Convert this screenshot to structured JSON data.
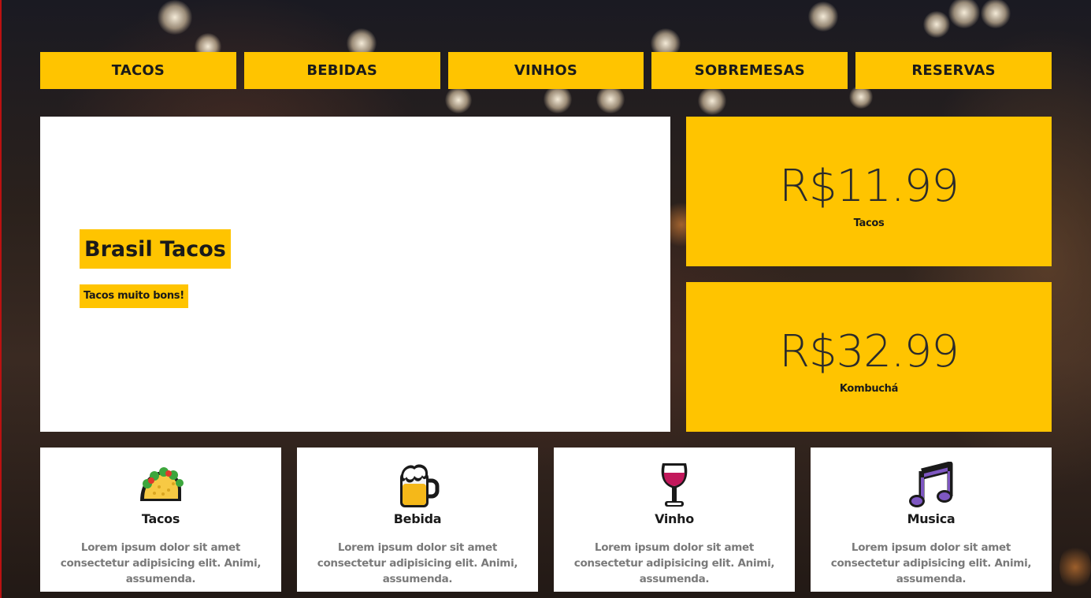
{
  "nav": {
    "items": [
      {
        "label": "TACOS"
      },
      {
        "label": "BEBIDAS"
      },
      {
        "label": "VINHOS"
      },
      {
        "label": "SOBREMESAS"
      },
      {
        "label": "RESERVAS"
      }
    ]
  },
  "hero": {
    "title": "Brasil Tacos",
    "subtitle": "Tacos muito bons!"
  },
  "prices": [
    {
      "value": "R$11.99",
      "label": "Tacos"
    },
    {
      "value": "R$32.99",
      "label": "Kombuchá"
    }
  ],
  "cards": [
    {
      "icon": "taco-icon",
      "title": "Tacos",
      "text": "Lorem ipsum dolor sit amet consectetur adipisicing elit. Animi, assumenda."
    },
    {
      "icon": "beer-mug-icon",
      "title": "Bebida",
      "text": "Lorem ipsum dolor sit amet consectetur adipisicing elit. Animi, assumenda."
    },
    {
      "icon": "wine-glass-icon",
      "title": "Vinho",
      "text": "Lorem ipsum dolor sit amet consectetur adipisicing elit. Animi, assumenda."
    },
    {
      "icon": "music-notes-icon",
      "title": "Musica",
      "text": "Lorem ipsum dolor sit amet consectetur adipisicing elit. Animi, assumenda."
    }
  ],
  "colors": {
    "accent": "#ffc400",
    "card": "#ffffff",
    "text": "#1a1a1a",
    "muted": "#7a7a7a"
  }
}
